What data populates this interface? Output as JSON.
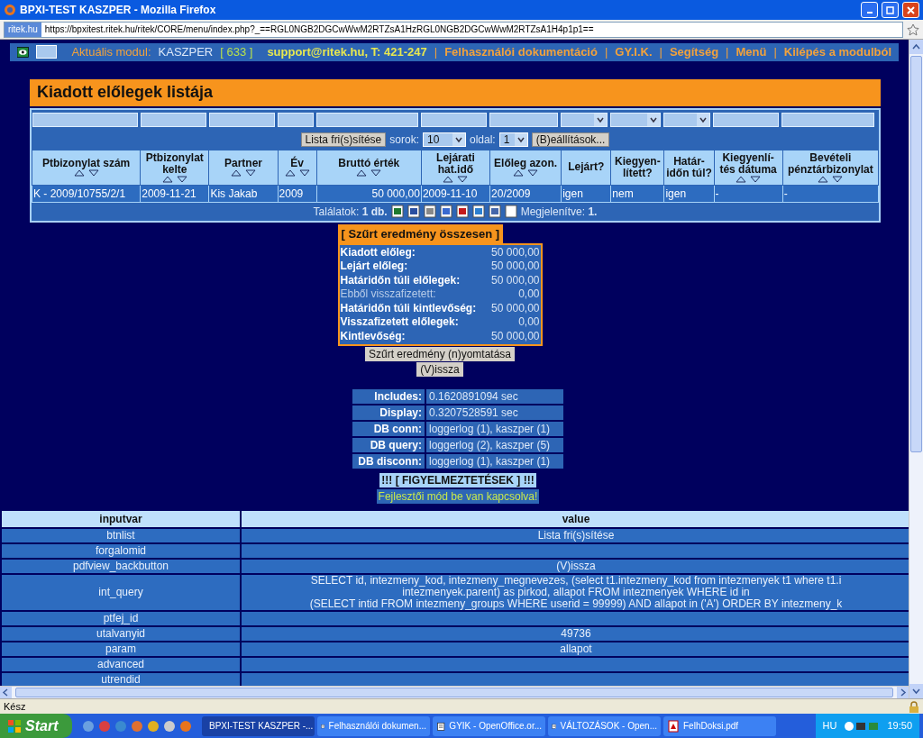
{
  "window": {
    "title": "BPXI-TEST KASZPER - Mozilla Firefox"
  },
  "address_bar": {
    "site": "ritek.hu",
    "url": "https://bpxitest.ritek.hu/ritek/CORE/menu/index.php?_==RGL0NGB2DGCwWwM2RTZsA1HzRGL0NGB2DGCwWwM2RTZsA1H4p1p1=="
  },
  "module_bar": {
    "label": "Aktuális modul:",
    "module": "KASZPER",
    "count": "[ 633 ]",
    "separator": "|",
    "links": [
      {
        "label": "support@ritek.hu, T: 421-247",
        "kind": "contact"
      },
      {
        "label": "Felhasználói dokumentáció",
        "kind": "link"
      },
      {
        "label": "GY.I.K.",
        "kind": "link"
      },
      {
        "label": "Segítség",
        "kind": "link"
      },
      {
        "label": "Menü",
        "kind": "link"
      },
      {
        "label": "Kilépés a modulból",
        "kind": "link"
      }
    ]
  },
  "page_title": "Kiadott előlegek listája",
  "filters": [
    {
      "kind": "text"
    },
    {
      "kind": "text"
    },
    {
      "kind": "text"
    },
    {
      "kind": "text"
    },
    {
      "kind": "text"
    },
    {
      "kind": "text"
    },
    {
      "kind": "text"
    },
    {
      "kind": "select"
    },
    {
      "kind": "select"
    },
    {
      "kind": "select"
    },
    {
      "kind": "text"
    },
    {
      "kind": "text"
    }
  ],
  "toolbar": {
    "refresh_button": "Lista fri(s)sítése",
    "rows_label": "sorok:",
    "rows_value": "10",
    "page_label": "oldal:",
    "page_value": "1",
    "settings_button": "(B)eállítások..."
  },
  "columns": [
    {
      "label": "Ptbizonylat szám",
      "sortable": true
    },
    {
      "label": "Ptbizonylat kelte",
      "sortable": true
    },
    {
      "label": "Partner",
      "sortable": true
    },
    {
      "label": "Év",
      "sortable": true
    },
    {
      "label": "Bruttó érték",
      "sortable": true
    },
    {
      "label": "Lejárati hat.idő",
      "sortable": true
    },
    {
      "label": "Előleg azon.",
      "sortable": true
    },
    {
      "label": "Lejárt?",
      "sortable": false
    },
    {
      "label": "Kiegyen-lített?",
      "sortable": false
    },
    {
      "label": "Határ-időn túl?",
      "sortable": false
    },
    {
      "label": "Kiegyenlí-tés dátuma",
      "sortable": true
    },
    {
      "label": "Bevételi pénztárbizonylat",
      "sortable": true
    }
  ],
  "rows": [
    [
      "K - 2009/10755/2/1",
      "2009-11-21",
      "Kis Jakab",
      "2009",
      "50 000,00",
      "2009-11-10",
      "20/2009",
      "igen",
      "nem",
      "igen",
      "-",
      "-"
    ]
  ],
  "table_footer": {
    "results": "Találatok: **1 db.**",
    "shown": "Megjelenítve: **1.**"
  },
  "summary": {
    "title": "[ Szűrt eredmény összesen ]",
    "rows": [
      {
        "label": "Kiadott előleg:",
        "value": "50 000,00",
        "bold": true
      },
      {
        "label": "Lejárt előleg:",
        "value": "50 000,00",
        "bold": true
      },
      {
        "label": "Határidőn túli előlegek:",
        "value": "50 000,00",
        "bold": true
      },
      {
        "label": "Ebből visszafizetett:",
        "value": "0,00",
        "bold": false
      },
      {
        "label": "Határidőn túli kintlevőség:",
        "value": "50 000,00",
        "bold": true
      },
      {
        "label": "Visszafizetett előlegek:",
        "value": "0,00",
        "bold": true
      },
      {
        "label": "Kintlevőség:",
        "value": "50 000,00",
        "bold": true
      }
    ],
    "print_button": "Szűrt eredmény (n)yomtatása",
    "back_button": "(V)issza"
  },
  "debug": [
    {
      "label": "Includes:",
      "value": "0.1620891094 sec"
    },
    {
      "label": "Display:",
      "value": "0.3207528591 sec"
    },
    {
      "label": "DB conn:",
      "value": "loggerlog (1), kaszper (1)"
    },
    {
      "label": "DB query:",
      "value": "loggerlog (2), kaszper (5)"
    },
    {
      "label": "DB disconn:",
      "value": "loggerlog (1), kaszper (1)"
    }
  ],
  "warnings": {
    "title": "!!! [ FIGYELMEZTETÉSEK ] !!!",
    "message": "Fejlesztői mód be van kapcsolva!"
  },
  "inputvars": {
    "columns": [
      "inputvar",
      "value"
    ],
    "rows": [
      {
        "name": "btnlist",
        "lines": [
          "Lista fri(s)sítése"
        ]
      },
      {
        "name": "forgalomid"
      },
      {
        "name": "pdfview_backbutton",
        "lines": [
          "(V)issza"
        ]
      },
      {
        "name": "int_query",
        "lines": [
          "SELECT id, intezmeny_kod, intezmeny_megnevezes, (select t1.intezmeny_kod from intezmenyek t1 where t1.i",
          "intezmenyek.parent) as pirkod, allapot FROM intezmenyek WHERE id in",
          "(SELECT intid FROM intezmeny_groups WHERE userid = 99999) AND allapot in ('A') ORDER BY intezmeny_k"
        ]
      },
      {
        "name": "ptfej_id"
      },
      {
        "name": "utalvanyid",
        "lines": [
          "49736"
        ]
      },
      {
        "name": "param",
        "lines": [
          "allapot"
        ]
      },
      {
        "name": "advanced"
      },
      {
        "name": "utrendid"
      }
    ]
  },
  "status_bar": "Kész",
  "taskbar": {
    "start": "Start",
    "tasks": [
      {
        "label": "BPXI-TEST KASZPER -...",
        "kind": "browser",
        "selected": true
      },
      {
        "label": "Felhasználói dokumen...",
        "kind": "office",
        "selected": false
      },
      {
        "label": "GYIK - OpenOffice.or...",
        "kind": "office",
        "selected": false
      },
      {
        "label": "VÁLTOZÁSOK - Open...",
        "kind": "office",
        "selected": false
      },
      {
        "label": "FelhDoksi.pdf",
        "kind": "pdf",
        "selected": false
      }
    ],
    "language": "HU",
    "clock": "19:50"
  }
}
